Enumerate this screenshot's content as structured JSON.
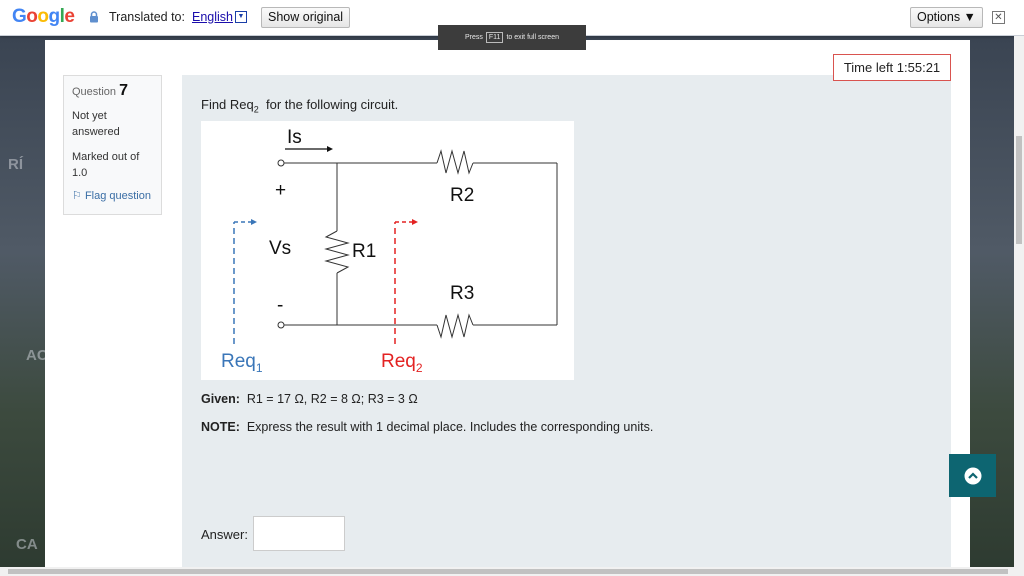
{
  "translate_bar": {
    "logo": [
      "G",
      "o",
      "o",
      "g",
      "l",
      "e"
    ],
    "translated_to": "Translated to:",
    "language": "English",
    "show_original": "Show original",
    "options": "Options ▼"
  },
  "fullscreen_notice": {
    "press": "Press",
    "key": "F11",
    "rest": "to exit full screen"
  },
  "timer": "Time left 1:55:21",
  "background_text": {
    "a": "RÍ",
    "b": "AC",
    "c": "CA"
  },
  "question_info": {
    "label": "Question",
    "number": "7",
    "status_1": "Not yet",
    "status_2": "answered",
    "marked_1": "Marked out of",
    "marked_2": "1.0",
    "flag": "Flag question"
  },
  "question": {
    "text_prefix": "Find Req",
    "text_sub": "2",
    "text_suffix": "for the following circuit."
  },
  "circuit": {
    "is_label": "Is",
    "plus": "+",
    "minus": "-",
    "vs_label": "Vs",
    "r1_label": "R1",
    "r2_label": "R2",
    "r3_label": "R3",
    "req1_label": "Req",
    "req1_sub": "1",
    "req2_label": "Req",
    "req2_sub": "2",
    "colors": {
      "req1": "#3a76b8",
      "req2": "#e32222"
    }
  },
  "given": {
    "label": "Given:",
    "text": "R1 = 17 Ω, R2 = 8 Ω; R3 = 3 Ω"
  },
  "note": {
    "label": "NOTE:",
    "text": "Express the result with 1 decimal place. Includes the corresponding units."
  },
  "answer": {
    "label": "Answer:",
    "value": ""
  }
}
